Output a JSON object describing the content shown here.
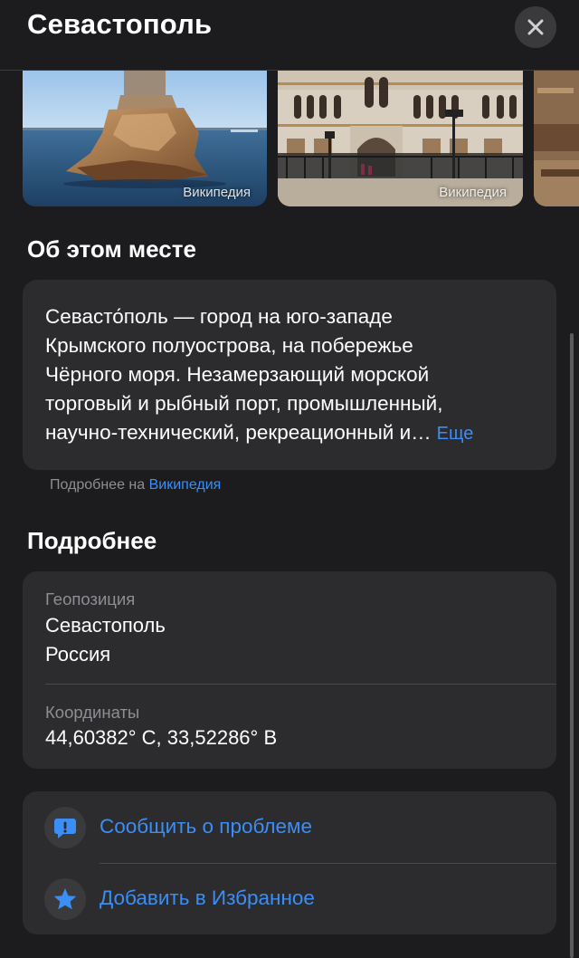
{
  "header": {
    "title": "Севастополь",
    "close_icon": "xmark-icon"
  },
  "photos": [
    {
      "credit": "Википедия",
      "subject": "monument-on-rock-in-sea"
    },
    {
      "credit": "Википедия",
      "subject": "cathedral-facade"
    },
    {
      "credit": "",
      "subject": "ruins"
    }
  ],
  "about": {
    "title": "Об этом месте",
    "lines": [
      "Севасто́поль — город на юго-западе",
      "Крымского полуострова, на побережье",
      "Чёрного моря. Незамерзающий морской",
      "торговый и рыбный порт, промышленный,",
      "научно-технический, рекреационный и…"
    ],
    "more_label": "Еще",
    "source_prefix": "Подробнее на",
    "source_link": "Википедия"
  },
  "details": {
    "title": "Подробнее",
    "location_label": "Геопозиция",
    "location_city": "Севастополь",
    "location_country": "Россия",
    "coords_label": "Координаты",
    "coords_value": "44,60382° С, 33,52286° В"
  },
  "actions": [
    {
      "label": "Сообщить о проблеме",
      "icon": "exclamation-bubble-icon"
    },
    {
      "label": "Добавить в Избранное",
      "icon": "star-icon"
    }
  ],
  "colors": {
    "background": "#1c1c1e",
    "card": "#2c2c2e",
    "accent": "#3a8ef6",
    "secondary_text": "#8e8e93"
  }
}
